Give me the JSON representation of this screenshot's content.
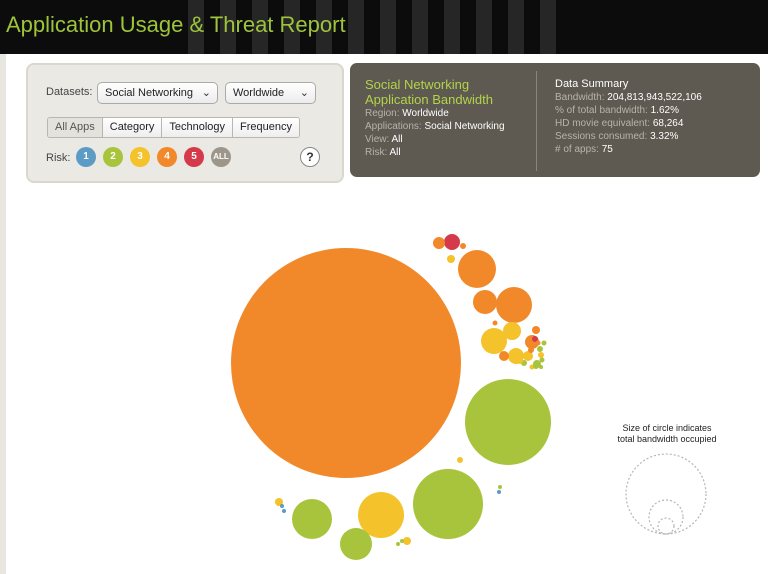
{
  "header": {
    "title": "Application Usage & Threat Report"
  },
  "controls": {
    "datasets_label": "Datasets:",
    "dataset_select": "Social Networking",
    "region_select": "Worldwide",
    "tabs": [
      "All Apps",
      "Category",
      "Technology",
      "Frequency"
    ],
    "active_tab": "All Apps",
    "risk_label": "Risk:",
    "risk_levels": [
      {
        "label": "1",
        "color": "#5b9bc4"
      },
      {
        "label": "2",
        "color": "#a8c43c"
      },
      {
        "label": "3",
        "color": "#f4c22a"
      },
      {
        "label": "4",
        "color": "#f1892a"
      },
      {
        "label": "5",
        "color": "#d43a4a"
      },
      {
        "label": "ALL",
        "color": "#9d978b"
      }
    ],
    "help_label": "?"
  },
  "summary": {
    "title_line1": "Social Networking",
    "title_line2": "Application Bandwidth",
    "region_label": "Region:",
    "region_value": "Worldwide",
    "applications_label": "Applications:",
    "applications_value": "Social Networking",
    "view_label": "View:",
    "view_value": "All",
    "risk_label": "Risk:",
    "risk_value": "All"
  },
  "data_summary": {
    "heading": "Data Summary",
    "bandwidth_label": "Bandwidth:",
    "bandwidth_value": "204,813,943,522,106",
    "pct_label": "% of total bandwidth:",
    "pct_value": "1.62%",
    "hd_label": "HD movie equivalent:",
    "hd_value": "68,264",
    "sessions_label": "Sessions consumed:",
    "sessions_value": "3.32%",
    "apps_label": "# of apps:",
    "apps_value": "75"
  },
  "legend": {
    "line1": "Size of circle indicates",
    "line2": "total bandwidth occupied"
  },
  "colors": {
    "risk1": "#5b9bc4",
    "risk2": "#a8c43c",
    "risk3": "#f4c22a",
    "risk4": "#f1892a",
    "risk5": "#d43a4a",
    "accent": "#9ec43c"
  },
  "chart_data": {
    "type": "scatter",
    "note_free": true,
    "bubbles": [
      {
        "risk": 4,
        "size": 115
      },
      {
        "risk": 2,
        "size": 43
      },
      {
        "risk": 2,
        "size": 35
      },
      {
        "risk": 3,
        "size": 23
      },
      {
        "risk": 2,
        "size": 20
      },
      {
        "risk": 2,
        "size": 16
      },
      {
        "risk": 4,
        "size": 19
      },
      {
        "risk": 4,
        "size": 18
      },
      {
        "risk": 4,
        "size": 12
      },
      {
        "risk": 3,
        "size": 13
      },
      {
        "risk": 3,
        "size": 9
      },
      {
        "risk": 3,
        "size": 8
      },
      {
        "risk": 5,
        "size": 8
      },
      {
        "risk": 4,
        "size": 6
      },
      {
        "risk": 4,
        "size": 7
      },
      {
        "risk": 4,
        "size": 5
      },
      {
        "risk": 3,
        "size": 5
      },
      {
        "risk": 4,
        "size": 4
      },
      {
        "risk": 2,
        "size": 4
      },
      {
        "risk": 3,
        "size": 4
      },
      {
        "risk": 4,
        "size": 3
      },
      {
        "risk": 2,
        "size": 3
      },
      {
        "risk": 5,
        "size": 3
      },
      {
        "risk": 3,
        "size": 3
      },
      {
        "risk": 2,
        "size": 3
      },
      {
        "risk": 3,
        "size": 3
      },
      {
        "risk": 4,
        "size": 2.5
      },
      {
        "risk": 2,
        "size": 2.5
      },
      {
        "risk": 3,
        "size": 2.5
      },
      {
        "risk": 3,
        "size": 4
      },
      {
        "risk": 1,
        "size": 2
      },
      {
        "risk": 1,
        "size": 2
      },
      {
        "risk": 3,
        "size": 4
      },
      {
        "risk": 2,
        "size": 2
      },
      {
        "risk": 1,
        "size": 2
      },
      {
        "risk": 2,
        "size": 2
      },
      {
        "risk": 2,
        "size": 2
      },
      {
        "risk": 2,
        "size": 2
      },
      {
        "risk": 2,
        "size": 3
      },
      {
        "risk": 4,
        "size": 3
      },
      {
        "risk": 3,
        "size": 3
      },
      {
        "risk": 2,
        "size": 2.5
      },
      {
        "risk": 4,
        "size": 2.5
      }
    ]
  }
}
